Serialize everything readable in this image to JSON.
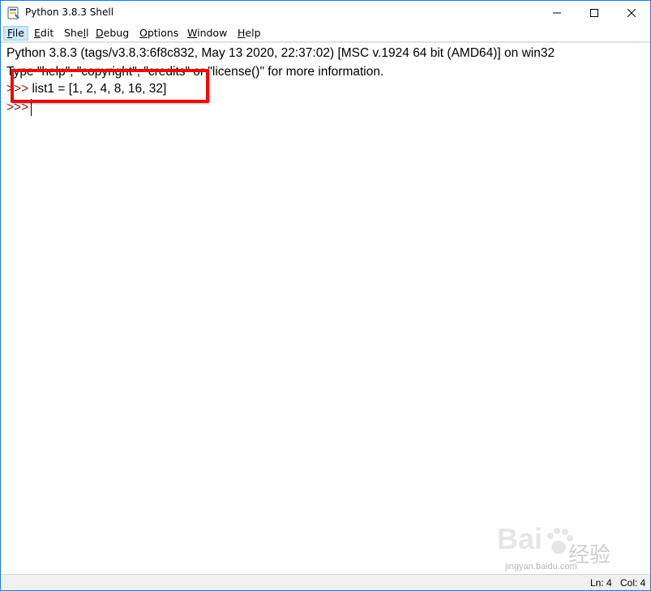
{
  "window": {
    "title": "Python 3.8.3 Shell",
    "icon": "python-idle-icon",
    "controls": {
      "minimize": "minimize-icon",
      "maximize": "maximize-icon",
      "close": "close-icon"
    }
  },
  "menubar": {
    "items": [
      {
        "label_u": "F",
        "label_rest": "ile",
        "active": true
      },
      {
        "label_u": "E",
        "label_rest": "dit",
        "active": false
      },
      {
        "label_pre": "She",
        "label_u": "l",
        "label_rest": "l",
        "active": false
      },
      {
        "label_u": "D",
        "label_rest": "ebug",
        "active": false
      },
      {
        "label_u": "O",
        "label_rest": "ptions",
        "active": false
      },
      {
        "label_u": "W",
        "label_rest": "indow",
        "active": false
      },
      {
        "label_u": "H",
        "label_rest": "elp",
        "active": false
      }
    ]
  },
  "shell": {
    "banner_line1": "Python 3.8.3 (tags/v3.8.3:6f8c832, May 13 2020, 22:37:02) [MSC v.1924 64 bit (AMD64)] on win32",
    "banner_line2": "Type \"help\", \"copyright\", \"credits\" or \"license()\" for more information.",
    "prompt": ">>>",
    "input_line": " list1 = [1, 2, 4, 8, 16, 32]",
    "prompt2": ">>>"
  },
  "statusbar": {
    "ln": "Ln: 4",
    "col": "Col: 4"
  },
  "watermark": {
    "brand": "Baidu",
    "brand_cn": "经验",
    "url": "jingyan.baidu.com"
  },
  "colors": {
    "highlight_box": "#e60d0d",
    "prompt": "#8a1a1a",
    "menu_active": "#cce8ff",
    "window_border": "#1f7ad6"
  }
}
